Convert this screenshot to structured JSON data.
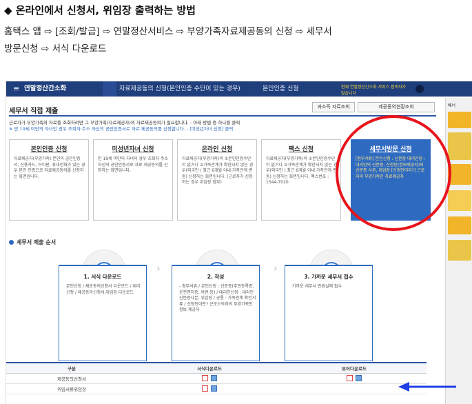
{
  "doc": {
    "title": "◆ 온라인에서 신청서, 위임장 출력하는 방법",
    "path_line1": "홈택스 앱 ⇨ [조회/발급] ⇨ 연말정산서비스 ⇨ 부양가족자료제공동의 신청 ⇨ 세무서",
    "path_line2": "방문신청 ⇨ 서식 다운로드"
  },
  "navbar": {
    "home_icon": "≡",
    "menu_title": "연말정산간소화",
    "sub_menu": "자료제공동의 신청(본인인증 수단이 있는 경우)",
    "sub_menu2": "본인인증 신청",
    "right_text": "현재 연말정산간소화 서비스 접속자가 많습니다"
  },
  "sidebar": {
    "tab": "배너"
  },
  "page": {
    "title": "세무서 직접 제출",
    "btn_result": "과소득 자료조회",
    "btn_apply": "제공동의현황조회",
    "notice_line1": "근로자가 부양가족의 자료를 조회하려면 그 부양가족(자료제공자)의 자료제공동의가 필요합니다. - 아래 방법 중 하나를 클릭",
    "notice_line2": "※ 만 19세 미만의 자녀인 경우 조회자 주소 자신의 공인인증서로 자료 제공동의를 신청합니다. - [미성년자녀 신청] 클릭"
  },
  "cards": [
    {
      "title": "본인인증 신청",
      "body": "자료제공자(부양가족) 본인의 공인인증서, 신용카드, 아이핀, 휴대전화가 있는 경우 본인 인증으로 자료제공동의를 신청하는 화면입니다."
    },
    {
      "title": "미성년자녀 신청",
      "body": "만 19세 미만의 자녀의 경우 조회자 주소 자신의 공인인증서로 자료 제공동의를 신청하는 화면입니다."
    },
    {
      "title": "온라인 신청",
      "body": "자료제공자(부양가족)의 ①본인인증수단이 없거나 ②가족관계가 확인되지 않는 경우(외국인 / 최근 6개월 이내 가족관계 변동) 신청하는 화면입니다. (근로자가 신청하는 경우 위임장 첨부)"
    },
    {
      "title": "팩스 신청",
      "body": "자료제공자(부양가족)의 ①본인인증수단이 없거나 ②가족관계가 확인되지 않는 경우(외국인 / 최근 6개월 이내 가족관계 변동) 신청하는 화면입니다. 팩스번호 : 1544-7020"
    },
    {
      "title": "세무서방문 신청",
      "body": "[첨부서류] 본인신청 : 신분증 대리신청 : 대리인의 신분증, 신청인(정보제공자)의 신분증 사본, 위임장 [신청인이라?] 근로자의 부양가족인 자료제공자"
    }
  ],
  "steps": {
    "section_title": "세무서 제출 순서",
    "items": [
      {
        "glyph": "⬇",
        "title": "1. 서식 다운로드",
        "body": "본인신청 / 제공동의신청서 다운로드 / 대리신청 / 제공동의신청서,위임장 다운로드"
      },
      {
        "glyph": "✎",
        "title": "2. 작성",
        "body": "- 첨부서류 / 본인신청 : 신분증(주민등록증, 운전면허증, 여권 등) / 대리인신청 : 대리인 신분증사본, 위임장 / 공통 : 가족관계 확인서류 / 신청인이란? 근로소득자의 부양가족인 정보 제공자"
      },
      {
        "glyph": "▤",
        "title": "3. 가까운 세무서 접수",
        "body": "가까운 세무서 민원실에 접수"
      }
    ]
  },
  "table": {
    "headers": [
      "구분",
      "서식다운로드",
      "뷰어다운로드"
    ],
    "rows": [
      {
        "label": "제공동의신청서"
      },
      {
        "label": "위임서류위임장"
      }
    ]
  },
  "colors": {
    "nav": "#1f3e7c",
    "accent": "#2e6bc0",
    "ring": "#e8141b",
    "pointer": "#1e3fe6"
  }
}
